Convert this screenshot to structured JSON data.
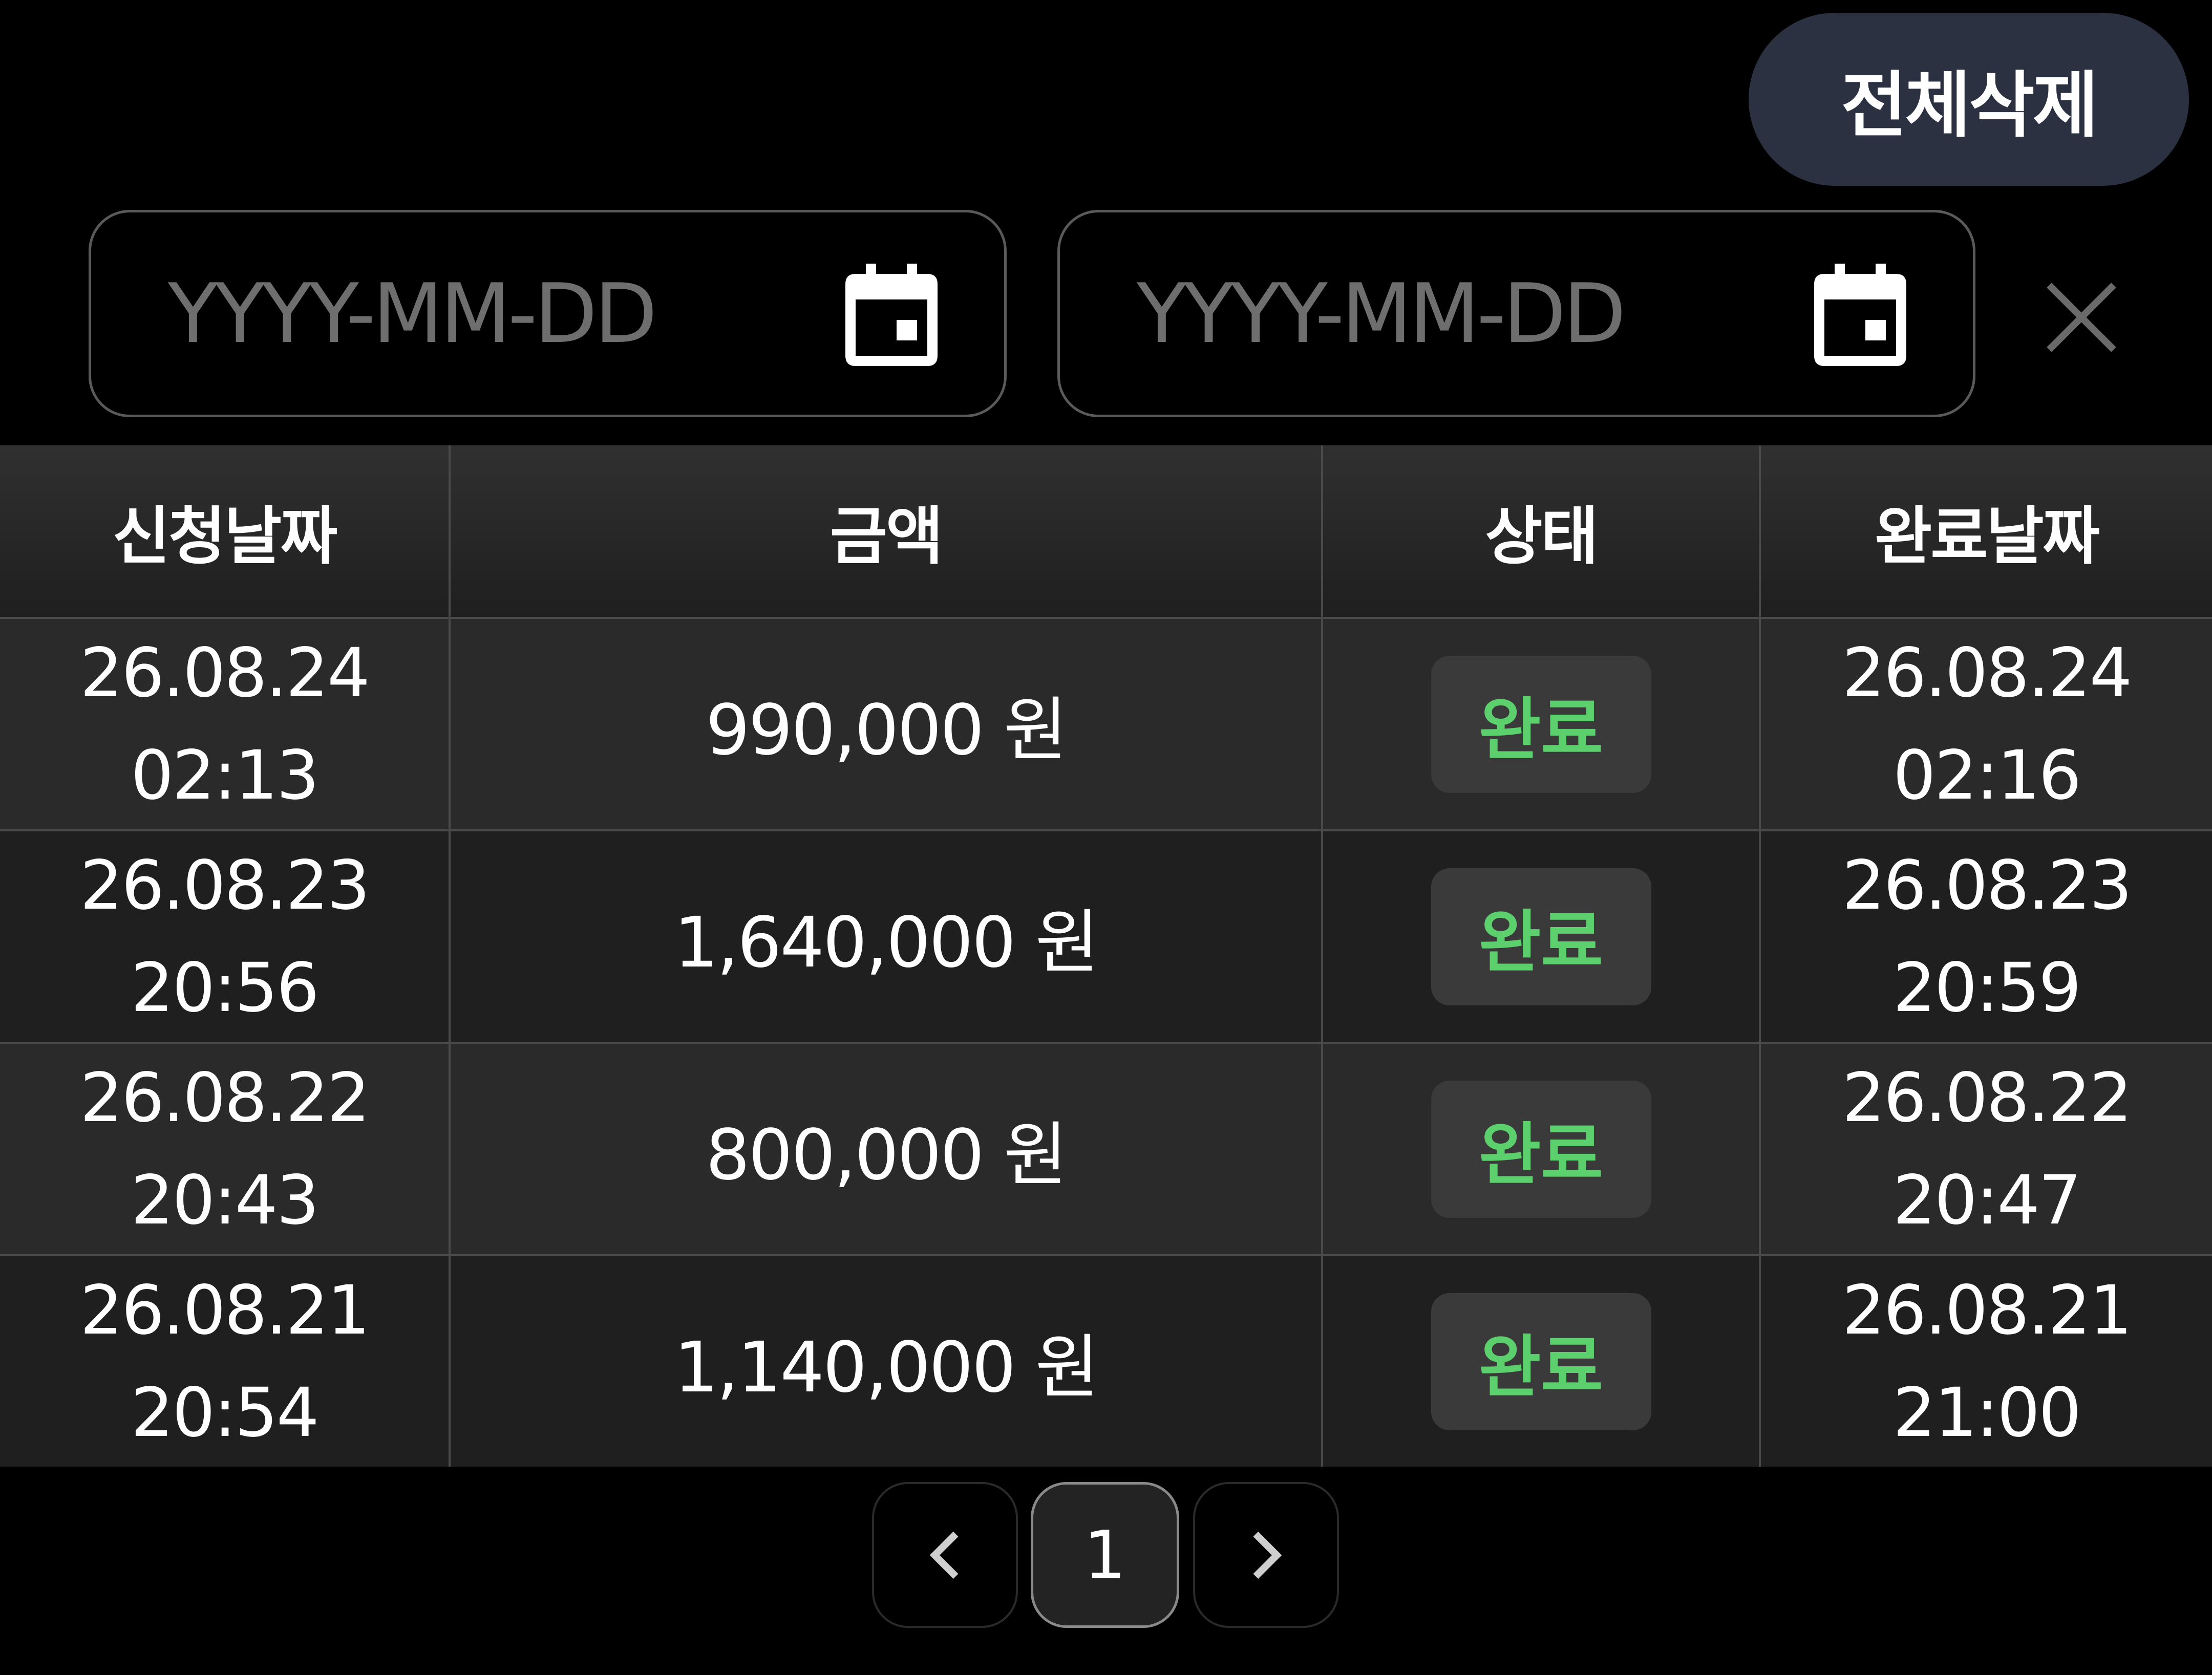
{
  "toolbar": {
    "delete_all_label": "전체삭제"
  },
  "filters": {
    "start_date_placeholder": "YYYY-MM-DD",
    "end_date_placeholder": "YYYY-MM-DD"
  },
  "table": {
    "headers": [
      "신청날짜",
      "금액",
      "상태",
      "완료날짜"
    ],
    "rows": [
      {
        "request_date": "26.08.24",
        "request_time": "02:13",
        "amount": "990,000 원",
        "status": "완료",
        "complete_date": "26.08.24",
        "complete_time": "02:16"
      },
      {
        "request_date": "26.08.23",
        "request_time": "20:56",
        "amount": "1,640,000 원",
        "status": "완료",
        "complete_date": "26.08.23",
        "complete_time": "20:59"
      },
      {
        "request_date": "26.08.22",
        "request_time": "20:43",
        "amount": "800,000 원",
        "status": "완료",
        "complete_date": "26.08.22",
        "complete_time": "20:47"
      },
      {
        "request_date": "26.08.21",
        "request_time": "20:54",
        "amount": "1,140,000 원",
        "status": "완료",
        "complete_date": "26.08.21",
        "complete_time": "21:00"
      }
    ]
  },
  "pagination": {
    "current_page": "1"
  },
  "colors": {
    "accent_button": "#2c3142",
    "status_complete": "#5cd06d",
    "background": "#000000"
  },
  "icons": [
    "calendar-icon",
    "close-icon",
    "chevron-left-icon",
    "chevron-right-icon"
  ]
}
